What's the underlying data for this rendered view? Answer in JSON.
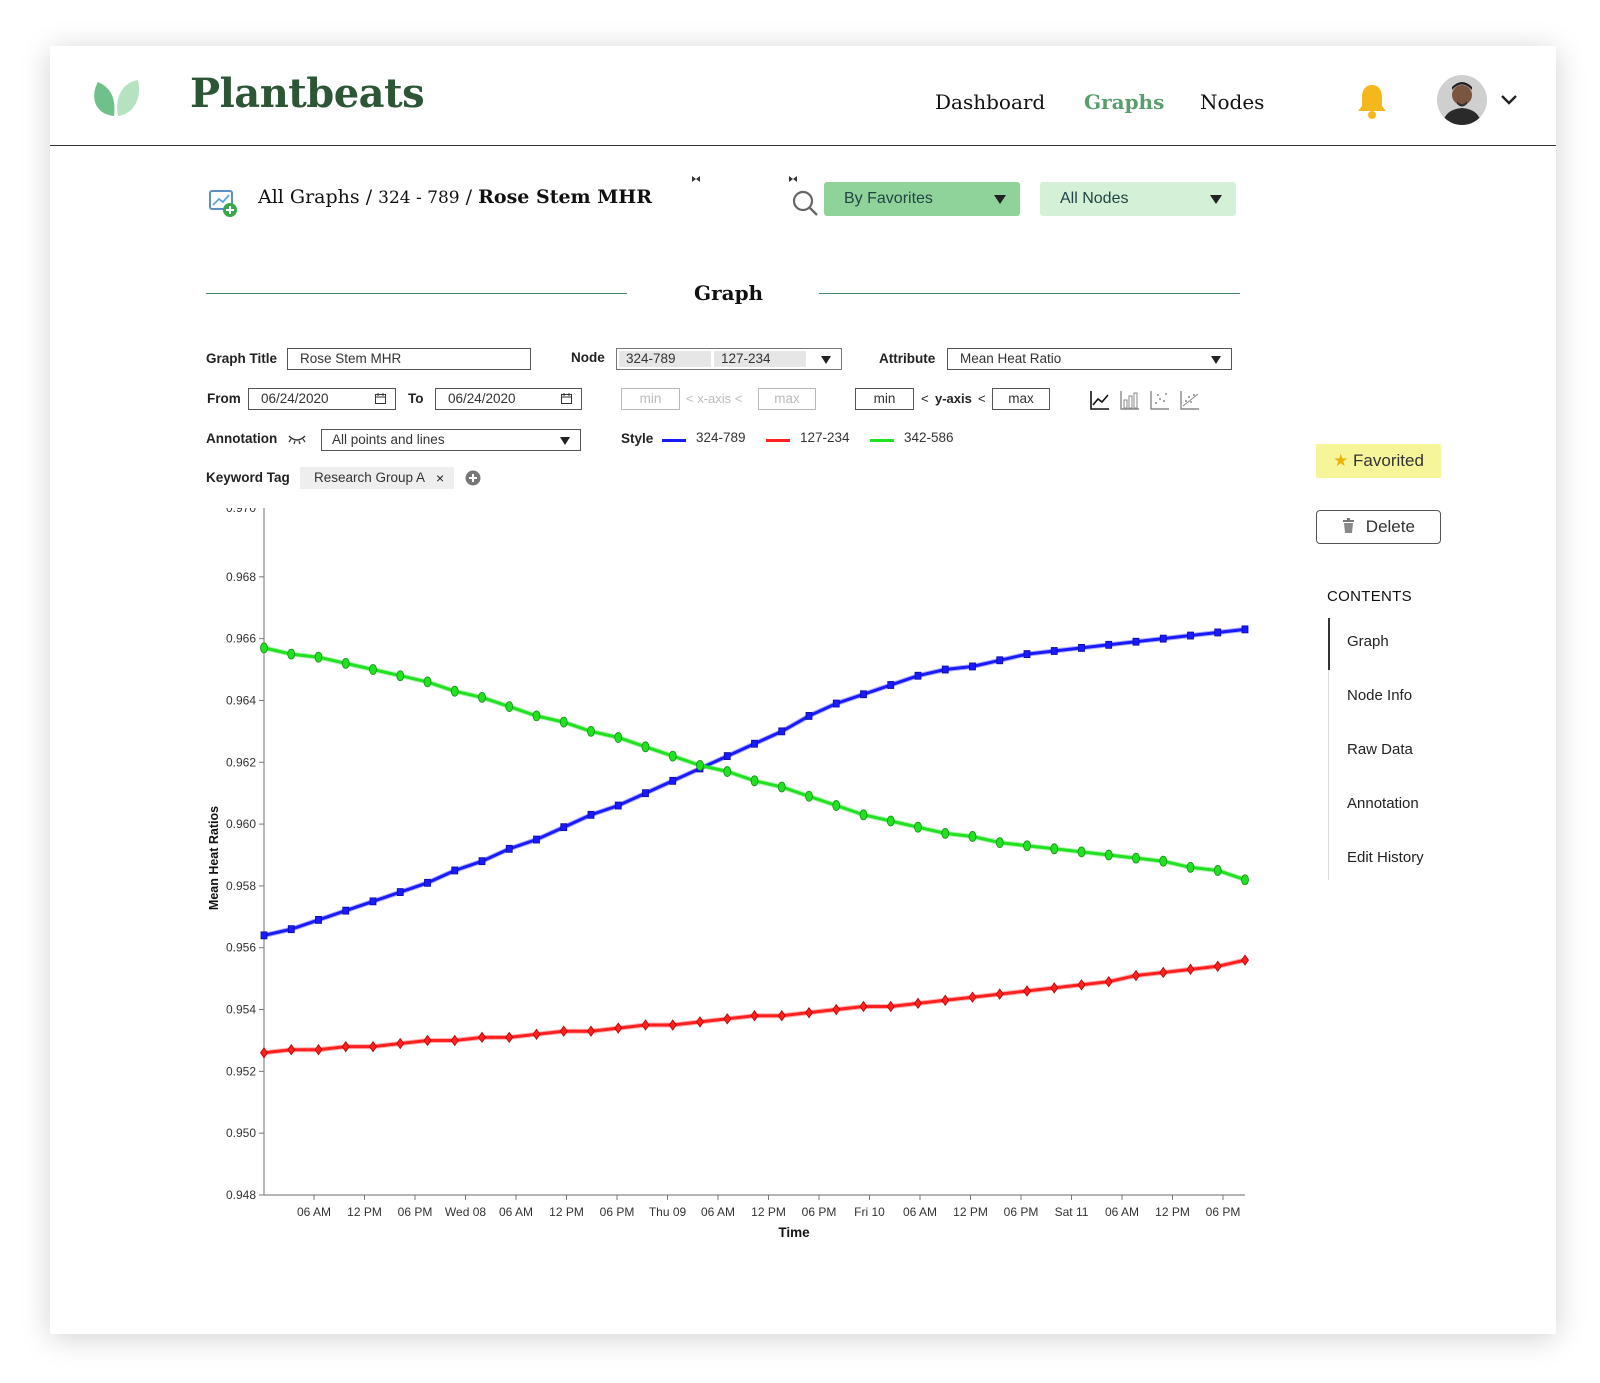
{
  "header": {
    "brand": "Plantbeats",
    "nav": [
      {
        "label": "Dashboard",
        "active": false
      },
      {
        "label": "Graphs",
        "active": true
      },
      {
        "label": "Nodes",
        "active": false
      }
    ],
    "bell_color": "#f5b81c"
  },
  "breadcrumb": {
    "root": "All Graphs",
    "sep": "/",
    "node": "324 - 789",
    "current": "Rose Stem MHR"
  },
  "filters": {
    "favorites": {
      "label": "By Favorites",
      "color": "#8fd29a"
    },
    "nodes": {
      "label": "All Nodes",
      "color": "#d4f1d8"
    }
  },
  "section": {
    "title": "Graph"
  },
  "form": {
    "graph_title_label": "Graph Title",
    "graph_title_value": "Rose Stem MHR",
    "node_label": "Node",
    "node_values": [
      "324-789",
      "127-234"
    ],
    "attribute_label": "Attribute",
    "attribute_value": "Mean Heat Ratio",
    "from_label": "From",
    "from_value": "06/24/2020",
    "to_label": "To",
    "to_value": "06/24/2020",
    "x_min": "min",
    "x_axis_text": "< x-axis <",
    "x_max": "max",
    "y_min": "min",
    "y_lt": "<",
    "y_axis_text": "y-axis",
    "y_lt2": "<",
    "y_max": "max",
    "annotation_label": "Annotation",
    "annotation_value": "All points and lines",
    "style_label": "Style",
    "style_series": [
      {
        "name": "324-789",
        "color": "#1a1aff"
      },
      {
        "name": "127-234",
        "color": "#ff2020"
      },
      {
        "name": "342-586",
        "color": "#22e022"
      }
    ],
    "keyword_label": "Keyword Tag",
    "keyword_value": "Research Group A",
    "keyword_remove": "×"
  },
  "panel": {
    "favorited": "Favorited",
    "favorited_star": "★",
    "delete": "Delete",
    "contents_title": "CONTENTS",
    "contents": [
      "Graph",
      "Node Info",
      "Raw Data",
      "Annotation",
      "Edit History"
    ]
  },
  "chart_data": {
    "type": "line",
    "title": "",
    "xlabel": "Time",
    "ylabel": "Mean Heat Ratios",
    "ylim": [
      0.948,
      0.97
    ],
    "yticks": [
      "0.948",
      "0.950",
      "0.952",
      "0.954",
      "0.956",
      "0.958",
      "0.960",
      "0.962",
      "0.964",
      "0.966",
      "0.968"
    ],
    "top_tick_partial": "0.970",
    "x_tick_labels": [
      "06 AM",
      "12 PM",
      "06 PM",
      "Wed 08",
      "06 AM",
      "12 PM",
      "06 PM",
      "Thu 09",
      "06 AM",
      "12 PM",
      "06 PM",
      "Fri 10",
      "06 AM",
      "12 PM",
      "06 PM",
      "Sat 11",
      "06 AM",
      "12 PM",
      "06 PM"
    ],
    "grid": false,
    "series": [
      {
        "name": "324-789",
        "color": "#1a1aff",
        "marker": "square",
        "values": [
          0.9564,
          0.9566,
          0.9569,
          0.9572,
          0.9575,
          0.9578,
          0.9581,
          0.9585,
          0.9588,
          0.9592,
          0.9595,
          0.9599,
          0.9603,
          0.9606,
          0.961,
          0.9614,
          0.9618,
          0.9622,
          0.9626,
          0.963,
          0.9635,
          0.9639,
          0.9642,
          0.9645,
          0.9648,
          0.965,
          0.9651,
          0.9653,
          0.9655,
          0.9656,
          0.9657,
          0.9658,
          0.9659,
          0.966,
          0.9661,
          0.9662,
          0.9663
        ]
      },
      {
        "name": "127-234",
        "color": "#ff2020",
        "marker": "diamond",
        "values": [
          0.9526,
          0.9527,
          0.9527,
          0.9528,
          0.9528,
          0.9529,
          0.953,
          0.953,
          0.9531,
          0.9531,
          0.9532,
          0.9533,
          0.9533,
          0.9534,
          0.9535,
          0.9535,
          0.9536,
          0.9537,
          0.9538,
          0.9538,
          0.9539,
          0.954,
          0.9541,
          0.9541,
          0.9542,
          0.9543,
          0.9544,
          0.9545,
          0.9546,
          0.9547,
          0.9548,
          0.9549,
          0.9551,
          0.9552,
          0.9553,
          0.9554,
          0.9556
        ]
      },
      {
        "name": "342-586",
        "color": "#22e022",
        "marker": "circle",
        "values": [
          0.9657,
          0.9655,
          0.9654,
          0.9652,
          0.965,
          0.9648,
          0.9646,
          0.9643,
          0.9641,
          0.9638,
          0.9635,
          0.9633,
          0.963,
          0.9628,
          0.9625,
          0.9622,
          0.9619,
          0.9617,
          0.9614,
          0.9612,
          0.9609,
          0.9606,
          0.9603,
          0.9601,
          0.9599,
          0.9597,
          0.9596,
          0.9594,
          0.9593,
          0.9592,
          0.9591,
          0.959,
          0.9589,
          0.9588,
          0.9586,
          0.9585,
          0.9582
        ]
      }
    ]
  }
}
